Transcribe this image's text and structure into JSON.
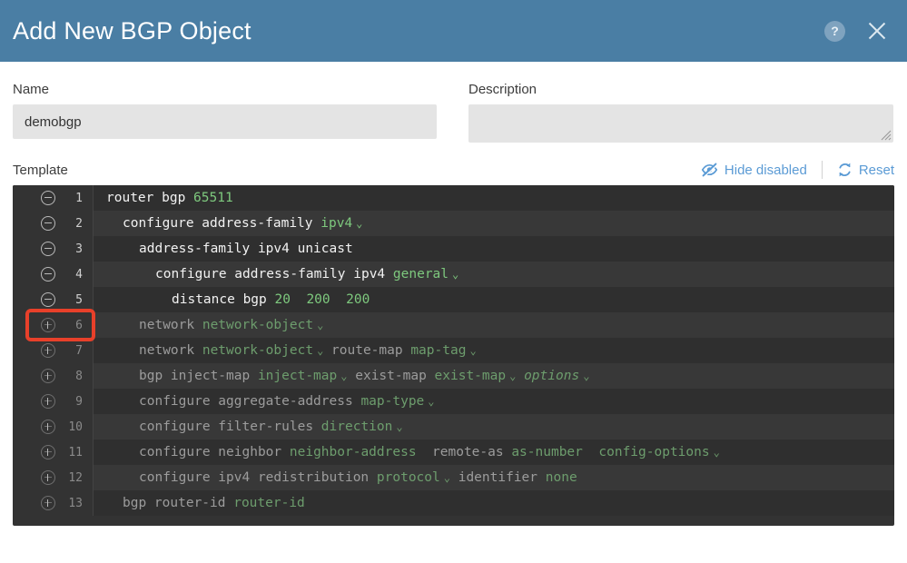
{
  "header": {
    "title": "Add New BGP Object",
    "help_icon": "help-circle-icon",
    "help_glyph": "?",
    "close_icon": "close-icon",
    "background_color": "#4a7ea4"
  },
  "form": {
    "name": {
      "label": "Name",
      "value": "demobgp",
      "placeholder": ""
    },
    "description": {
      "label": "Description",
      "value": "",
      "placeholder": ""
    }
  },
  "template_bar": {
    "label": "Template",
    "hide_disabled": {
      "label": "Hide disabled",
      "icon": "eye-slash-icon"
    },
    "reset": {
      "label": "Reset",
      "icon": "refresh-icon"
    },
    "link_color": "#5b9bd5"
  },
  "editor": {
    "annotation": {
      "target_line": 6,
      "color": "#e8402a"
    },
    "lines": [
      {
        "number": "1",
        "state": "enabled",
        "toggle": "collapse-minus-icon",
        "indent": 0,
        "tokens": [
          {
            "text": "router bgp ",
            "type": "kw"
          },
          {
            "text": "65511",
            "type": "val"
          }
        ]
      },
      {
        "number": "2",
        "state": "enabled",
        "toggle": "collapse-minus-icon",
        "indent": 1,
        "tokens": [
          {
            "text": "configure address-family ",
            "type": "kw"
          },
          {
            "text": "ipv4",
            "type": "val",
            "chevron": true
          }
        ]
      },
      {
        "number": "3",
        "state": "enabled",
        "toggle": "collapse-minus-icon",
        "indent": 2,
        "tokens": [
          {
            "text": "address-family ipv4 unicast",
            "type": "kw"
          }
        ]
      },
      {
        "number": "4",
        "state": "enabled",
        "toggle": "collapse-minus-icon",
        "indent": 3,
        "tokens": [
          {
            "text": "configure address-family ipv4 ",
            "type": "kw"
          },
          {
            "text": "general",
            "type": "val",
            "chevron": true
          }
        ]
      },
      {
        "number": "5",
        "state": "enabled",
        "toggle": "collapse-minus-icon",
        "indent": 4,
        "tokens": [
          {
            "text": "distance bgp ",
            "type": "kw"
          },
          {
            "text": "20",
            "type": "val"
          },
          {
            "text": "  ",
            "type": "kw"
          },
          {
            "text": "200",
            "type": "val"
          },
          {
            "text": "  ",
            "type": "kw"
          },
          {
            "text": "200",
            "type": "val"
          }
        ]
      },
      {
        "number": "6",
        "state": "disabled",
        "toggle": "expand-plus-icon",
        "indent": 2,
        "tokens": [
          {
            "text": "network ",
            "type": "kw"
          },
          {
            "text": "network-object",
            "type": "val",
            "chevron": true
          }
        ]
      },
      {
        "number": "7",
        "state": "disabled",
        "toggle": "expand-plus-icon",
        "indent": 2,
        "tokens": [
          {
            "text": "network ",
            "type": "kw"
          },
          {
            "text": "network-object",
            "type": "val",
            "chevron": true
          },
          {
            "text": " route-map ",
            "type": "kw"
          },
          {
            "text": "map-tag",
            "type": "val",
            "chevron": true
          }
        ]
      },
      {
        "number": "8",
        "state": "disabled",
        "toggle": "expand-plus-icon",
        "indent": 2,
        "tokens": [
          {
            "text": "bgp inject-map ",
            "type": "kw"
          },
          {
            "text": "inject-map",
            "type": "val",
            "chevron": true
          },
          {
            "text": " exist-map ",
            "type": "kw"
          },
          {
            "text": "exist-map",
            "type": "val",
            "chevron": true
          },
          {
            "text": " ",
            "type": "kw"
          },
          {
            "text": "options",
            "type": "val",
            "italic": true,
            "chevron": true
          }
        ]
      },
      {
        "number": "9",
        "state": "disabled",
        "toggle": "expand-plus-icon",
        "indent": 2,
        "tokens": [
          {
            "text": "configure aggregate-address ",
            "type": "kw"
          },
          {
            "text": "map-type",
            "type": "val",
            "chevron": true
          }
        ]
      },
      {
        "number": "10",
        "state": "disabled",
        "toggle": "expand-plus-icon",
        "indent": 2,
        "tokens": [
          {
            "text": "configure filter-rules ",
            "type": "kw"
          },
          {
            "text": "direction",
            "type": "val",
            "chevron": true
          }
        ]
      },
      {
        "number": "11",
        "state": "disabled",
        "toggle": "expand-plus-icon",
        "indent": 2,
        "tokens": [
          {
            "text": "configure neighbor ",
            "type": "kw"
          },
          {
            "text": "neighbor-address",
            "type": "val"
          },
          {
            "text": "  remote-as ",
            "type": "kw"
          },
          {
            "text": "as-number",
            "type": "val"
          },
          {
            "text": "  ",
            "type": "kw"
          },
          {
            "text": "config-options",
            "type": "val",
            "chevron": true
          }
        ]
      },
      {
        "number": "12",
        "state": "disabled",
        "toggle": "expand-plus-icon",
        "indent": 2,
        "tokens": [
          {
            "text": "configure ipv4 redistribution ",
            "type": "kw"
          },
          {
            "text": "protocol",
            "type": "val",
            "chevron": true
          },
          {
            "text": " identifier ",
            "type": "kw"
          },
          {
            "text": "none",
            "type": "val"
          }
        ]
      },
      {
        "number": "13",
        "state": "disabled",
        "toggle": "expand-plus-icon",
        "indent": 1,
        "tokens": [
          {
            "text": "bgp router-id ",
            "type": "kw"
          },
          {
            "text": "router-id",
            "type": "val"
          }
        ]
      }
    ]
  }
}
